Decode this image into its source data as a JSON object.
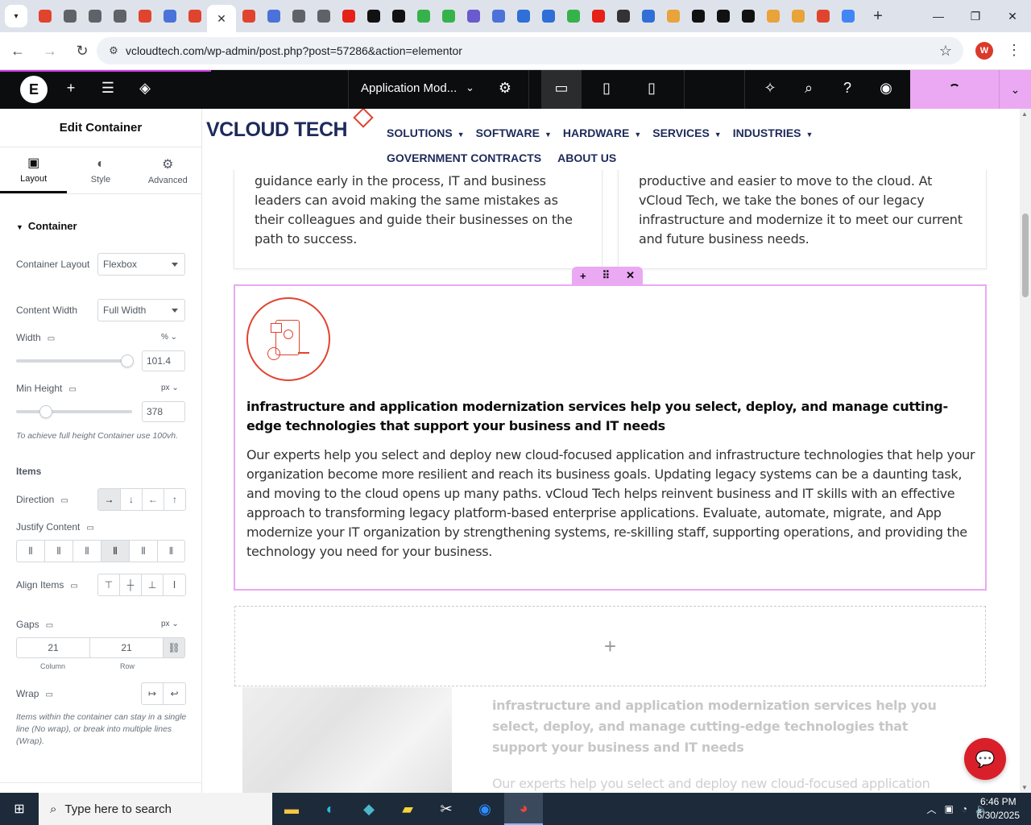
{
  "browser": {
    "tabs": [
      {
        "icon": "gem-red-icon",
        "color": "#e0442f"
      },
      {
        "icon": "globe-icon",
        "color": "#5f6368"
      },
      {
        "icon": "globe-icon",
        "color": "#5f6368"
      },
      {
        "icon": "globe-icon",
        "color": "#5f6368"
      },
      {
        "icon": "gem-red-icon",
        "color": "#e0442f"
      },
      {
        "icon": "checkmark-blue-icon",
        "color": "#4a72d9"
      },
      {
        "icon": "gem-red-icon",
        "color": "#e0442f"
      },
      {
        "icon": "close-icon",
        "color": "#333333",
        "active": true
      },
      {
        "icon": "gem-red-icon",
        "color": "#e0442f"
      },
      {
        "icon": "tab-icon",
        "color": "#4a72d9"
      },
      {
        "icon": "tab-icon",
        "color": "#5f6368"
      },
      {
        "icon": "globe-icon",
        "color": "#5f6368"
      },
      {
        "icon": "youtube-icon",
        "color": "#e62117"
      },
      {
        "icon": "openai-icon",
        "color": "#111111"
      },
      {
        "icon": "openai-icon",
        "color": "#111111"
      },
      {
        "icon": "green-leaf-icon",
        "color": "#36b24a"
      },
      {
        "icon": "green-leaf-icon",
        "color": "#36b24a"
      },
      {
        "icon": "swirl-icon",
        "color": "#6a5acd"
      },
      {
        "icon": "tab-icon",
        "color": "#4a72d9"
      },
      {
        "icon": "blue-grid-icon",
        "color": "#2f6fd6"
      },
      {
        "icon": "blue-grid-icon",
        "color": "#2f6fd6"
      },
      {
        "icon": "green-leaf-icon",
        "color": "#36b24a"
      },
      {
        "icon": "youtube-icon",
        "color": "#e62117"
      },
      {
        "icon": "lock-icon",
        "color": "#333333"
      },
      {
        "icon": "speed-icon",
        "color": "#2f6fd6"
      },
      {
        "icon": "circle-icon",
        "color": "#e8a33a"
      },
      {
        "icon": "x-icon",
        "color": "#111111"
      },
      {
        "icon": "x-icon",
        "color": "#111111"
      },
      {
        "icon": "h-icon",
        "color": "#111111"
      },
      {
        "icon": "circle-icon",
        "color": "#e8a33a"
      },
      {
        "icon": "circle-icon",
        "color": "#e8a33a"
      },
      {
        "icon": "slash-icon",
        "color": "#e0442f"
      },
      {
        "icon": "google-icon",
        "color": "#4285f4"
      }
    ],
    "new_tab": "+",
    "url": "vcloudtech.com/wp-admin/post.php?post=57286&action=elementor",
    "profile_initial": "W"
  },
  "elementor": {
    "document_title": "Application Mod...",
    "publish_color": "#eaa9f2"
  },
  "panel": {
    "title": "Edit Container",
    "tabs": [
      {
        "label": "Layout",
        "icon": "layout-icon",
        "active": true
      },
      {
        "label": "Style",
        "icon": "half-circle-icon"
      },
      {
        "label": "Advanced",
        "icon": "gear-icon"
      }
    ],
    "section": "Container",
    "container_layout": {
      "label": "Container Layout",
      "value": "Flexbox"
    },
    "content_width": {
      "label": "Content Width",
      "value": "Full Width"
    },
    "width": {
      "label": "Width",
      "unit": "%",
      "value": "101.4",
      "fraction": 0.96
    },
    "min_height": {
      "label": "Min Height",
      "unit": "px",
      "value": "378",
      "fraction": 0.26
    },
    "min_height_hint": "To achieve full height Container use 100vh.",
    "items": "Items",
    "direction": "Direction",
    "justify_content": "Justify Content",
    "align_items": "Align Items",
    "gaps": {
      "label": "Gaps",
      "unit": "px",
      "column": "21",
      "row": "21",
      "column_label": "Column",
      "row_label": "Row"
    },
    "wrap": "Wrap",
    "wrap_hint": "Items within the container can stay in a single line (No wrap), or break into multiple lines (Wrap)."
  },
  "site": {
    "logo_text": "VCLOUD TECH",
    "menu_row1": [
      "SOLUTIONS",
      "SOFTWARE",
      "HARDWARE",
      "SERVICES",
      "INDUSTRIES"
    ],
    "menu_row2": [
      "GOVERNMENT CONTRACTS",
      "ABOUT US"
    ],
    "card_left_text": "guidance early in the process, IT and business leaders can avoid making the same mistakes as their colleagues and guide their businesses on the path to success.",
    "card_right_text": "productive and easier to move to the cloud. At vCloud Tech, we take the bones of our legacy infrastructure and modernize it to meet our current and future business needs.",
    "section_heading": "infrastructure and application modernization services help you select, deploy, and manage cutting-edge technologies that support your business and IT needs",
    "section_body": "Our experts help you select and deploy new cloud-focused application and infrastructure technologies that help your organization become more resilient and reach its business goals. Updating legacy systems can be a daunting task, and moving to the cloud opens up many paths. vCloud Tech helps reinvent business and IT skills with an effective approach to transforming legacy platform-based enterprise applications. Evaluate, automate, migrate, and App modernize your IT organization by strengthening systems, re-skilling staff, supporting operations, and providing the technology you need for your business.",
    "add_element": "+",
    "faded_heading": "infrastructure and application modernization services help you select, deploy, and manage cutting-edge technologies that support your business and IT needs",
    "faded_body": "Our experts help you select and deploy new cloud-focused application"
  },
  "taskbar": {
    "search_placeholder": "Type here to search",
    "time": "6:46 PM",
    "date": "6/30/2025"
  }
}
